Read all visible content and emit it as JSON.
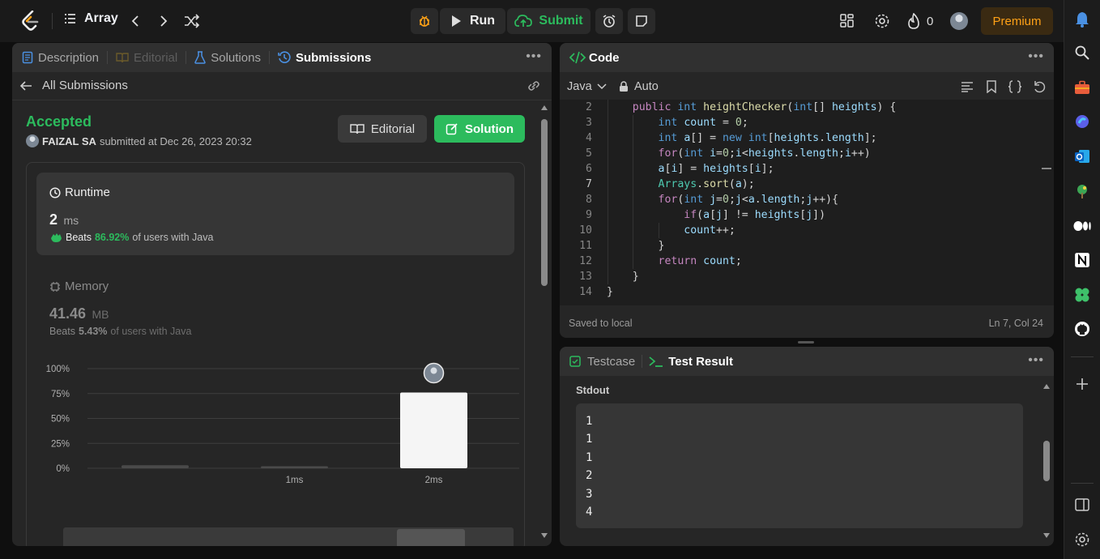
{
  "topbar": {
    "problem_list_label": "Array",
    "run_label": "Run",
    "submit_label": "Submit",
    "streak_count": "0",
    "premium_label": "Premium"
  },
  "left_tabs": {
    "description": "Description",
    "editorial": "Editorial",
    "solutions": "Solutions",
    "submissions": "Submissions"
  },
  "submission": {
    "back_label": "All Submissions",
    "status": "Accepted",
    "user": "FAIZAL SA",
    "submitted_text": "submitted at Dec 26, 2023 20:32",
    "editorial_btn": "Editorial",
    "solution_btn": "Solution",
    "runtime_label": "Runtime",
    "runtime_value": "2",
    "runtime_unit": "ms",
    "runtime_beats_prefix": "Beats",
    "runtime_beats_pct": "86.92%",
    "runtime_beats_suffix": "of users with Java",
    "memory_label": "Memory",
    "memory_value": "41.46",
    "memory_unit": "MB",
    "memory_beats_prefix": "Beats",
    "memory_beats_pct": "5.43%",
    "memory_beats_suffix": "of users with Java"
  },
  "chart_data": {
    "type": "bar",
    "categories": [
      "",
      "1ms",
      "2ms"
    ],
    "values": [
      3,
      2,
      76
    ],
    "ylim": [
      0,
      100
    ],
    "yticks": [
      "100%",
      "75%",
      "50%",
      "25%",
      "0%"
    ],
    "grid": true
  },
  "code_panel": {
    "title": "Code",
    "language": "Java",
    "mode": "Auto",
    "saved": "Saved to local",
    "cursor": "Ln 7, Col 24"
  },
  "test_panel": {
    "testcase_tab": "Testcase",
    "result_tab": "Test Result",
    "stdout_label": "Stdout",
    "stdout_lines": [
      "1",
      "1",
      "1",
      "2",
      "3",
      "4"
    ]
  },
  "colors": {
    "accent_green": "#2cbb5d",
    "accepted": "#2cbb5d",
    "premium": "#ffa116",
    "blue": "#4a90e2"
  }
}
